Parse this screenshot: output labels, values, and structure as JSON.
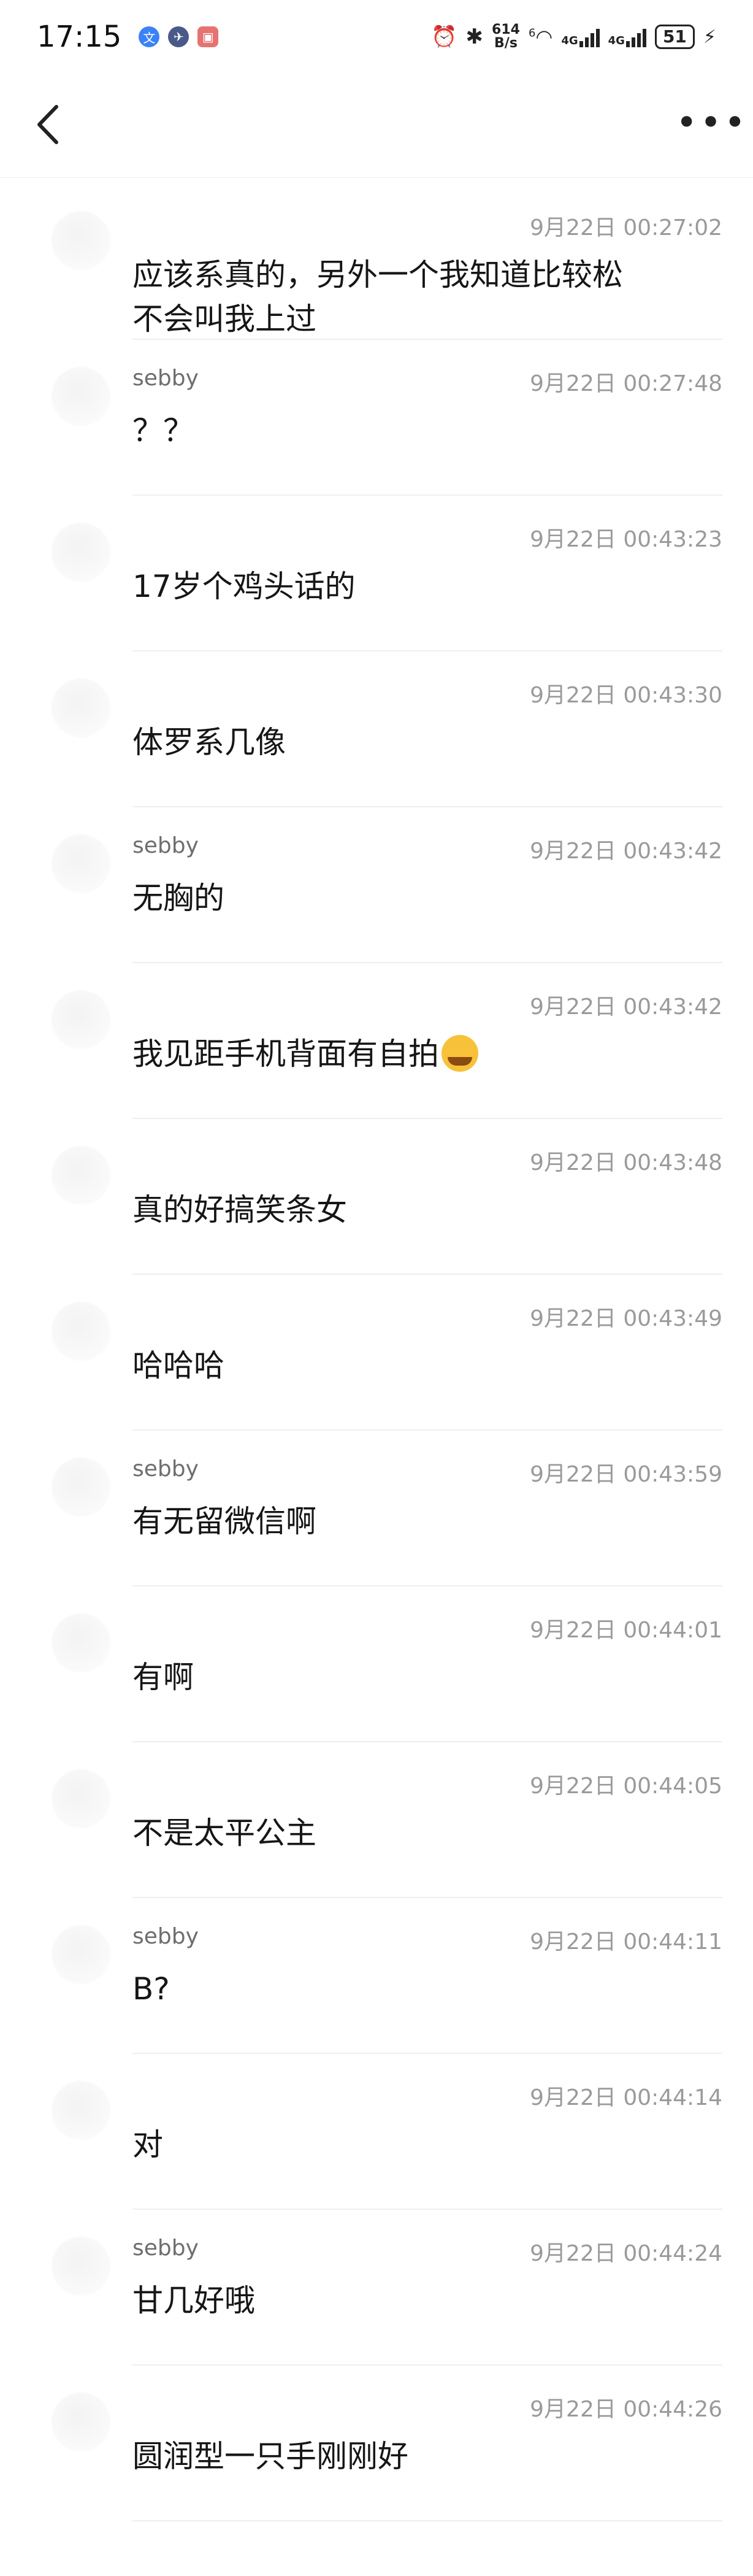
{
  "status_bar": {
    "time": "17:15",
    "net_speed_value": "614",
    "net_speed_unit": "B/s",
    "wifi_label": "6",
    "net_label_1": "4G",
    "net_label_2": "4G",
    "battery_level": "51"
  },
  "header": {
    "title": ""
  },
  "messages": [
    {
      "sender": "",
      "time": "9月22日 00:27:02",
      "text": "应该系真的，另外一个我知道比较松\n不会叫我上过"
    },
    {
      "sender": "sebby",
      "time": "9月22日 00:27:48",
      "text": "？？"
    },
    {
      "sender": "",
      "time": "9月22日 00:43:23",
      "text": "17岁个鸡头话的"
    },
    {
      "sender": "",
      "time": "9月22日 00:43:30",
      "text": "体罗系几像"
    },
    {
      "sender": "sebby",
      "time": "9月22日 00:43:42",
      "text": "无胸的"
    },
    {
      "sender": "",
      "time": "9月22日 00:43:42",
      "text": "我见距手机背面有自拍"
    },
    {
      "sender": "",
      "time": "9月22日 00:43:48",
      "text": "真的好搞笑条女"
    },
    {
      "sender": "",
      "time": "9月22日 00:43:49",
      "text": "哈哈哈"
    },
    {
      "sender": "sebby",
      "time": "9月22日 00:43:59",
      "text": "有无留微信啊"
    },
    {
      "sender": "",
      "time": "9月22日 00:44:01",
      "text": "有啊"
    },
    {
      "sender": "",
      "time": "9月22日 00:44:05",
      "text": "不是太平公主"
    },
    {
      "sender": "sebby",
      "time": "9月22日 00:44:11",
      "text": "B?"
    },
    {
      "sender": "",
      "time": "9月22日 00:44:14",
      "text": "对"
    },
    {
      "sender": "sebby",
      "time": "9月22日 00:44:24",
      "text": "甘几好哦"
    },
    {
      "sender": "",
      "time": "9月22日 00:44:26",
      "text": "圆润型一只手刚刚好"
    }
  ],
  "colors": {
    "background": "#ffffff",
    "text_primary": "#161616",
    "text_secondary": "#9a9a9a",
    "divider": "#efefef"
  },
  "icons": {
    "back": "chevron-left-icon",
    "more": "more-dots-icon",
    "emoji": "crying-laughing-emoji-icon"
  }
}
